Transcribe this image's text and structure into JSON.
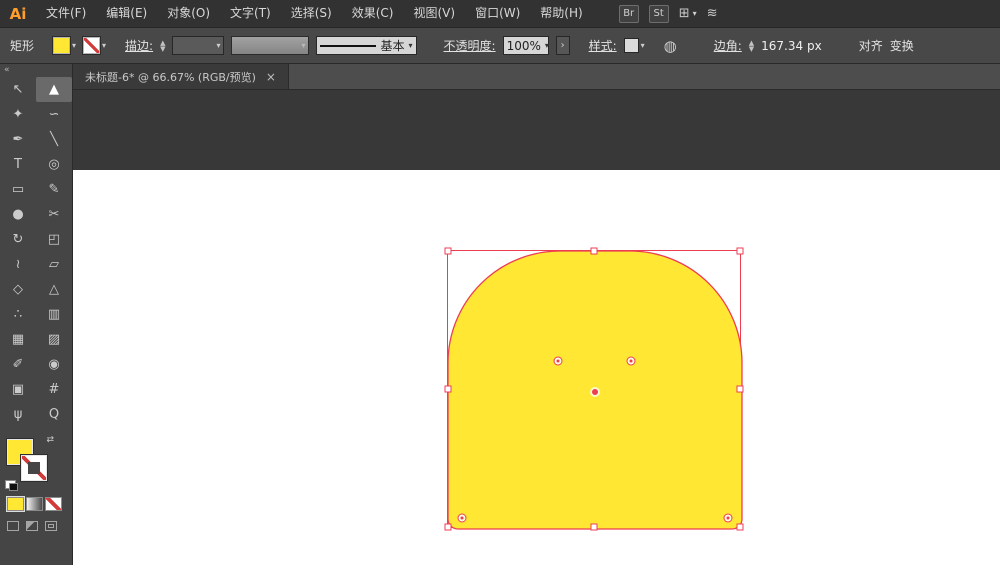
{
  "colors": {
    "yellow": "#ffe733",
    "selection": "#ee3d53"
  },
  "menubar": {
    "logo": "Ai",
    "items": [
      {
        "id": "file",
        "label": "文件(F)"
      },
      {
        "id": "edit",
        "label": "编辑(E)"
      },
      {
        "id": "object",
        "label": "对象(O)"
      },
      {
        "id": "type",
        "label": "文字(T)"
      },
      {
        "id": "select",
        "label": "选择(S)"
      },
      {
        "id": "effect",
        "label": "效果(C)"
      },
      {
        "id": "view",
        "label": "视图(V)"
      },
      {
        "id": "window",
        "label": "窗口(W)"
      },
      {
        "id": "help",
        "label": "帮助(H)"
      }
    ],
    "badges": [
      "Br",
      "St"
    ],
    "workspace_glyph": "⊞",
    "workspace_caret": "▾",
    "share_glyph": "≋"
  },
  "controlbar": {
    "tool_label": "矩形",
    "stroke_label": "描边:",
    "stroke_style": "基本",
    "opacity_label": "不透明度:",
    "opacity_value": "100%",
    "more_options": "›",
    "style_label": "样式:",
    "recolor_glyph": "◍",
    "corner_label": "边角:",
    "corner_value": "167.34 px",
    "align_label": "对齐",
    "transform_label": "变换"
  },
  "tab": {
    "title": "未标题-6* @ 66.67% (RGB/预览)",
    "close": "×"
  },
  "toolbar": {
    "collapse": "«",
    "tools": [
      {
        "name": "selection-tool",
        "glyph": "↖"
      },
      {
        "name": "direct-selection-tool",
        "glyph": "▲",
        "selected": true
      },
      {
        "name": "magic-wand-tool",
        "glyph": "✦"
      },
      {
        "name": "lasso-tool",
        "glyph": "∽"
      },
      {
        "name": "pen-tool",
        "glyph": "✒"
      },
      {
        "name": "paintbrush-tool",
        "glyph": "╲"
      },
      {
        "name": "type-tool",
        "glyph": "T"
      },
      {
        "name": "spiral-tool",
        "glyph": "◎"
      },
      {
        "name": "rectangle-tool",
        "glyph": "▭"
      },
      {
        "name": "pencil-tool",
        "glyph": "✎"
      },
      {
        "name": "blob-brush-tool",
        "glyph": "●"
      },
      {
        "name": "scissors-tool",
        "glyph": "✂"
      },
      {
        "name": "rotate-tool",
        "glyph": "↻"
      },
      {
        "name": "scale-tool",
        "glyph": "◰"
      },
      {
        "name": "width-tool",
        "glyph": "≀"
      },
      {
        "name": "free-transform-tool",
        "glyph": "▱"
      },
      {
        "name": "shape-builder-tool",
        "glyph": "◇"
      },
      {
        "name": "perspective-grid-tool",
        "glyph": "△"
      },
      {
        "name": "symbol-sprayer-tool",
        "glyph": "∴"
      },
      {
        "name": "column-graph-tool",
        "glyph": "▥"
      },
      {
        "name": "mesh-tool",
        "glyph": "▦"
      },
      {
        "name": "gradient-tool",
        "glyph": "▨"
      },
      {
        "name": "eyedropper-tool",
        "glyph": "✐"
      },
      {
        "name": "blend-tool",
        "glyph": "◉"
      },
      {
        "name": "artboard-tool",
        "glyph": "▣"
      },
      {
        "name": "slice-tool",
        "glyph": "#"
      },
      {
        "name": "hand-tool",
        "glyph": "ψ"
      },
      {
        "name": "zoom-tool",
        "glyph": "Q"
      }
    ]
  },
  "canvas": {
    "selected_shape": {
      "type": "rounded-rectangle",
      "fill": "#ffe733",
      "corner_radius": "167.34 px"
    }
  }
}
